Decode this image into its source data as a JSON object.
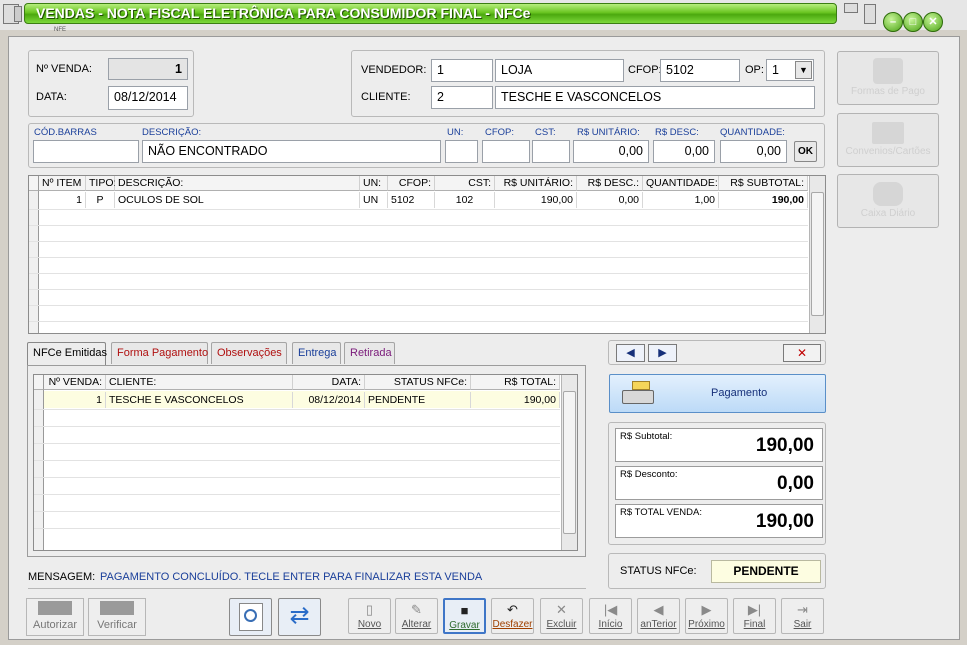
{
  "window": {
    "title": "VENDAS - NOTA FISCAL ELETRÔNICA PARA CONSUMIDOR FINAL - NFCe",
    "nfe_tag": "NFE"
  },
  "venda": {
    "numero_label": "Nº VENDA:",
    "numero": "1",
    "data_label": "DATA:",
    "data": "08/12/2014"
  },
  "vendedor": {
    "label": "VENDEDOR:",
    "codigo": "1",
    "nome": "LOJA",
    "cfop_label": "CFOP:",
    "cfop": "5102",
    "op_label": "OP:",
    "op": "1",
    "cliente_label": "CLIENTE:",
    "cliente_codigo": "2",
    "cliente_nome": "TESCHE E VASCONCELOS"
  },
  "entrada": {
    "codbarras_label": "CÓD.BARRAS",
    "descricao_label": "DESCRIÇÃO:",
    "descricao": "NÃO ENCONTRADO",
    "un_label": "UN:",
    "cfop_label": "CFOP:",
    "cst_label": "CST:",
    "unit_label": "R$ UNITÁRIO:",
    "desc_label": "R$ DESC:",
    "qtd_label": "QUANTIDADE:",
    "unit": "0,00",
    "desc": "0,00",
    "qtd": "0,00",
    "ok": "OK"
  },
  "items": {
    "headers": [
      "Nº ITEM",
      "TIPO:",
      "DESCRIÇÃO:",
      "UN:",
      "CFOP:",
      "CST:",
      "R$ UNITÁRIO:",
      "R$ DESC.:",
      "QUANTIDADE:",
      "R$ SUBTOTAL:"
    ],
    "rows": [
      [
        "1",
        "P",
        "OCULOS DE SOL",
        "UN",
        "5102",
        "102",
        "190,00",
        "0,00",
        "1,00",
        "190,00"
      ]
    ]
  },
  "tabs": [
    {
      "label": "NFCe Emitidas"
    },
    {
      "label": "Forma Pagamento"
    },
    {
      "label": "Observações"
    },
    {
      "label": "Entrega"
    },
    {
      "label": "Retirada"
    }
  ],
  "nfce": {
    "headers": [
      "Nº VENDA:",
      "CLIENTE:",
      "DATA:",
      "STATUS NFCe:",
      "R$ TOTAL:"
    ],
    "rows": [
      [
        "1",
        "TESCHE E VASCONCELOS",
        "08/12/2014",
        "PENDENTE",
        "190,00"
      ]
    ]
  },
  "side": {
    "forma_pago": "Formas de Pago",
    "convenios": "Convenios/Cartões",
    "caixa": "Caixa Diário"
  },
  "pagamento": {
    "label": "Pagamento",
    "close": "✕"
  },
  "totais": {
    "subtotal_label": "R$ Subtotal:",
    "subtotal": "190,00",
    "desconto_label": "R$ Desconto:",
    "desconto": "0,00",
    "total_label": "R$ TOTAL VENDA:",
    "total": "190,00"
  },
  "status": {
    "label": "STATUS NFCe:",
    "value": "PENDENTE"
  },
  "mensagem": {
    "label": "MENSAGEM:",
    "text": "PAGAMENTO CONCLUÍDO. TECLE ENTER PARA FINALIZAR ESTA VENDA"
  },
  "toolbar": {
    "autorizar": "Autorizar",
    "verificar": "Verificar",
    "novo": "Novo",
    "alterar": "Alterar",
    "gravar": "Gravar",
    "desfazer": "Desfazer",
    "excluir": "Excluir",
    "inicio": "Início",
    "anterior": "anTerior",
    "proximo": "Próximo",
    "final": "Final",
    "sair": "Sair"
  },
  "colors": {
    "title_green": "#5cbf1c",
    "label_blue": "#1a3f9a",
    "selected_row": "#fdfde1",
    "status_bg": "#fdfde1"
  }
}
